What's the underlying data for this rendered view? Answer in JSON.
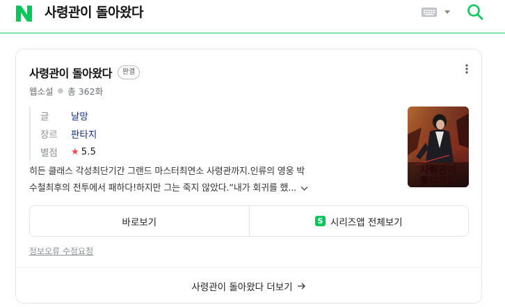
{
  "header": {
    "query": "사령관이 돌아왔다"
  },
  "card": {
    "title": "사령관이 돌아왔다",
    "badge": "완결",
    "meta": {
      "category": "웹소설",
      "episodes": "총 362화"
    },
    "info": [
      {
        "key": "글",
        "value": "날망"
      },
      {
        "key": "장르",
        "value": "판타지"
      },
      {
        "key": "별점",
        "value": "5.5"
      }
    ],
    "thumbnail": {
      "title_line1": "사령관이",
      "title_line2": "돌아왔다"
    },
    "description": {
      "line1": "히든 클래스 각성최단기간 그랜드 마스터최연소 사령관까지.인류의 영웅 박",
      "line2": "수철최후의 전투에서 패하다!하지만 그는 죽지 않았다.“내가 회귀를 했..."
    },
    "buttons": {
      "read": "바로보기",
      "series_app": "시리즈앱 전체보기",
      "series_icon_letter": "S"
    },
    "report": "정보오류 수정요청",
    "footer": "사령관이 돌아왔다 더보기"
  },
  "colors": {
    "brand_green": "#03c75a",
    "header_line": "#19ce60",
    "star_red": "#f0484a",
    "link_navy": "#0f2e7a"
  },
  "icons": [
    "naver-logo-icon",
    "keyboard-icon",
    "caret-down-icon",
    "search-icon",
    "more-vertical-icon",
    "star-icon",
    "chevron-down-icon",
    "series-app-icon",
    "arrow-right-icon"
  ]
}
